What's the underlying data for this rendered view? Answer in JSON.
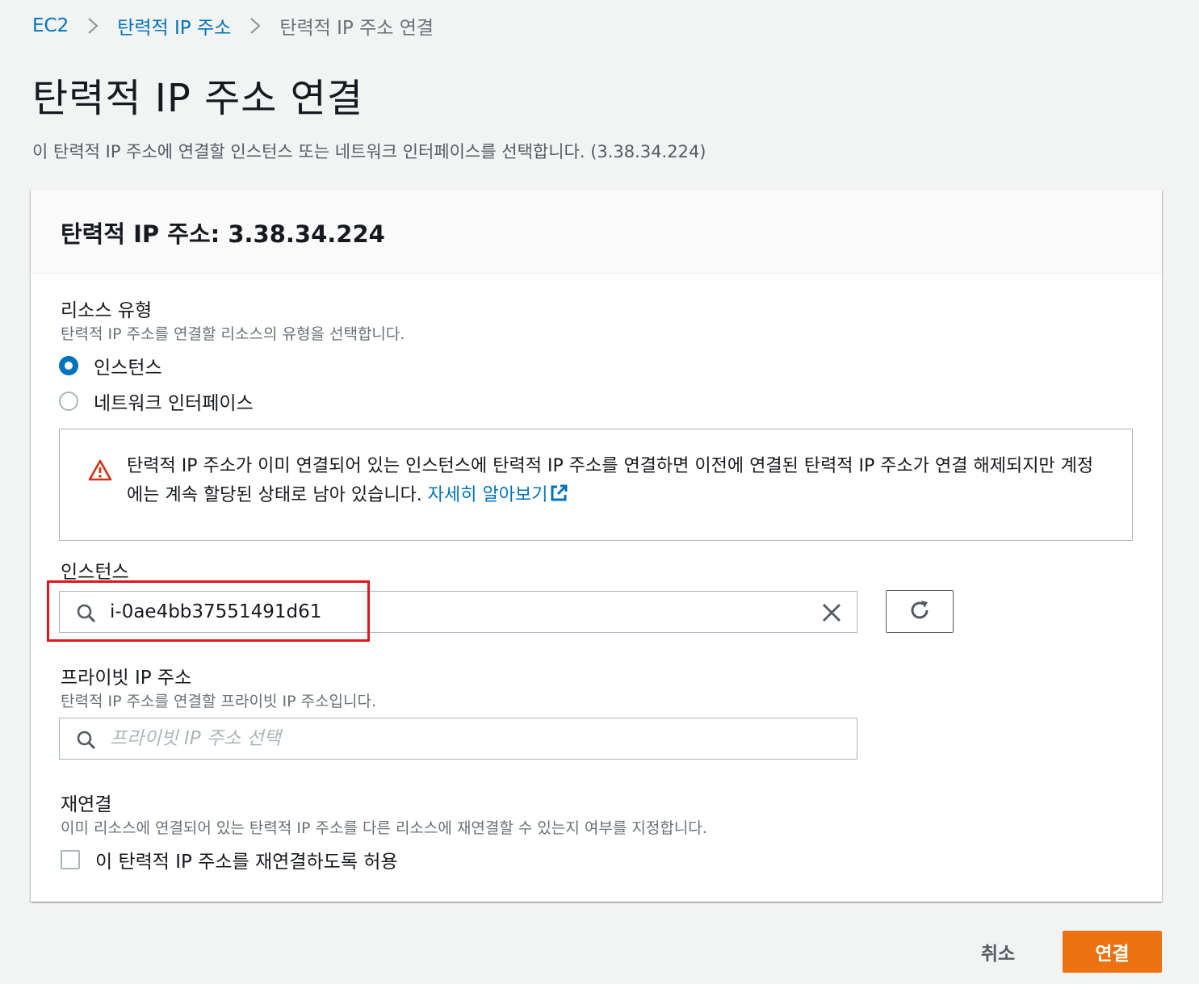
{
  "breadcrumb": {
    "items": [
      "EC2",
      "탄력적 IP 주소",
      "탄력적 IP 주소 연결"
    ]
  },
  "page": {
    "title": "탄력적 IP 주소 연결",
    "description": "이 탄력적 IP 주소에 연결할 인스턴스 또는 네트워크 인터페이스를 선택합니다. (3.38.34.224)"
  },
  "panel": {
    "title": "탄력적 IP 주소: 3.38.34.224"
  },
  "resource_type": {
    "label": "리소스 유형",
    "description": "탄력적 IP 주소를 연결할 리소스의 유형을 선택합니다.",
    "options": [
      "인스턴스",
      "네트워크 인터페이스"
    ],
    "selected": "인스턴스"
  },
  "alert": {
    "text": "탄력적 IP 주소가 이미 연결되어 있는 인스턴스에 탄력적 IP 주소를 연결하면 이전에 연결된 탄력적 IP 주소가 연결 해제되지만 계정에는 계속 할당된 상태로 남아 있습니다. ",
    "link_text": "자세히 알아보기",
    "icon": "warning-icon"
  },
  "instance": {
    "label": "인스턴스",
    "value": "i-0ae4bb37551491d61"
  },
  "private_ip": {
    "label": "프라이빗 IP 주소",
    "description": "탄력적 IP 주소를 연결할 프라이빗 IP 주소입니다.",
    "placeholder": "프라이빗 IP 주소 선택"
  },
  "reassociation": {
    "label": "재연결",
    "description": "이미 리소스에 연결되어 있는 탄력적 IP 주소를 다른 리소스에 재연결할 수 있는지 여부를 지정합니다.",
    "checkbox_label": "이 탄력적 IP 주소를 재연결하도록 허용",
    "checked": false
  },
  "actions": {
    "cancel": "취소",
    "associate": "연결"
  },
  "colors": {
    "link": "#0073bb",
    "primary": "#ec7211",
    "warning": "#d13212",
    "highlight": "#e1151b"
  }
}
